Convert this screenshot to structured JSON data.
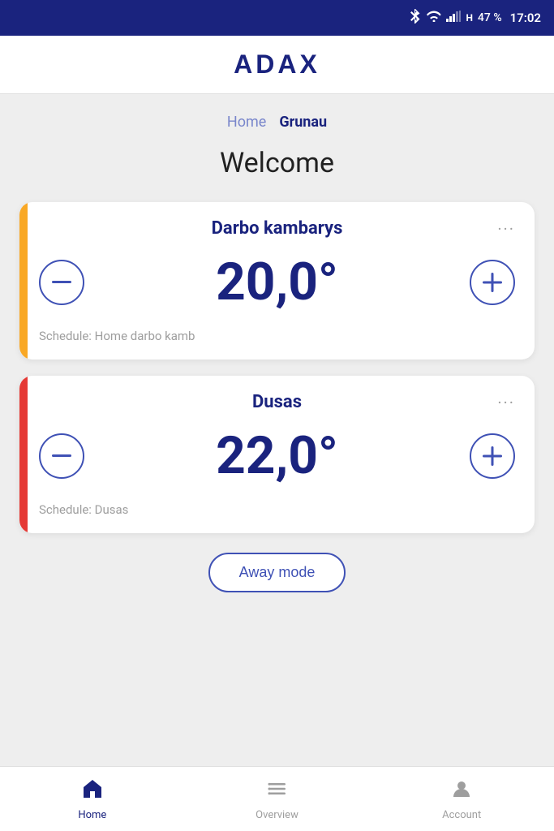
{
  "statusBar": {
    "battery": "47 %",
    "time": "17:02"
  },
  "header": {
    "logo": "ADAX"
  },
  "breadcrumb": {
    "home": "Home",
    "current": "Grunau"
  },
  "welcome": {
    "title": "Welcome"
  },
  "devices": [
    {
      "id": "device-1",
      "name": "Darbo kambarys",
      "temperature": "20,0°",
      "schedule": "Schedule: Home darbo kamb",
      "barColor": "#f9a825"
    },
    {
      "id": "device-2",
      "name": "Dusas",
      "temperature": "22,0°",
      "schedule": "Schedule: Dusas",
      "barColor": "#e53935"
    }
  ],
  "awayMode": {
    "label": "Away mode"
  },
  "bottomNav": {
    "home": "Home",
    "overview": "Overview",
    "account": "Account"
  }
}
